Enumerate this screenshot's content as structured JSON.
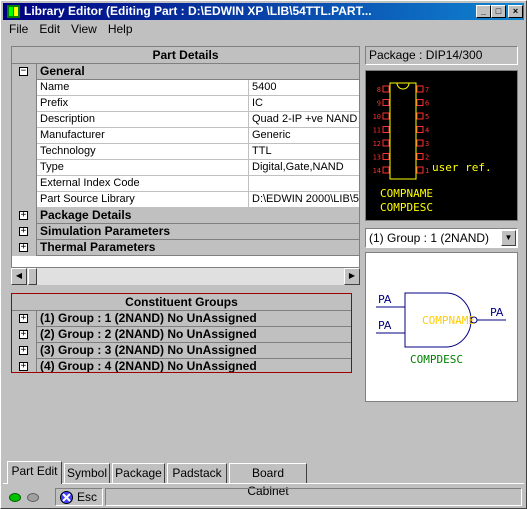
{
  "window": {
    "title": "Library Editor (Editing Part : D:\\EDWIN XP   \\LIB\\54TTL.PART...",
    "minimize": "_",
    "maximize": "□",
    "close": "×"
  },
  "menu": [
    "File",
    "Edit",
    "View",
    "Help"
  ],
  "part_details": {
    "header": "Part Details",
    "general_label": "General",
    "properties": [
      {
        "name": "Name",
        "value": "5400"
      },
      {
        "name": "Prefix",
        "value": "IC"
      },
      {
        "name": "Description",
        "value": "Quad 2-IP +ve NAND"
      },
      {
        "name": "Manufacturer",
        "value": "Generic"
      },
      {
        "name": "Technology",
        "value": "TTL"
      },
      {
        "name": "Type",
        "value": "Digital,Gate,NAND"
      },
      {
        "name": "External Index Code",
        "value": ""
      },
      {
        "name": "Part Source Library",
        "value": "D:\\EDWIN 2000\\LIB\\5"
      }
    ],
    "collapsed_sections": [
      "Package Details",
      "Simulation Parameters",
      "Thermal Parameters"
    ],
    "collapsed_symbol": "⊟",
    "expand_symbol": "+"
  },
  "constituent_groups": {
    "header": "Constituent Groups",
    "items": [
      "(1) Group : 1 (2NAND) No UnAssigned",
      "(2) Group : 2 (2NAND) No UnAssigned",
      "(3) Group : 3 (2NAND) No UnAssigned",
      "(4) Group : 4 (2NAND) No UnAssigned"
    ]
  },
  "package": {
    "label": "Package : DIP14/300",
    "left_pins": [
      "8",
      "9",
      "10",
      "11",
      "12",
      "13",
      "14"
    ],
    "right_pins": [
      "7",
      "6",
      "5",
      "4",
      "3",
      "2",
      "1"
    ],
    "user_ref": "user ref.",
    "compname": "COMPNAME",
    "compdesc": "COMPDESC"
  },
  "group_select": {
    "value": "(1) Group : 1 (2NAND)"
  },
  "symbol": {
    "pin_a": "PA",
    "pin_b": "PA",
    "pin_out": "PA",
    "compname": "COMPNAME",
    "compdesc": "COMPDESC"
  },
  "tabs": [
    "Part Edit",
    "Symbol",
    "Package",
    "Padstack",
    "Board Cabinet"
  ],
  "status": {
    "esc_label": "Esc"
  },
  "colors": {
    "title_start": "#000080",
    "title_end": "#1084d0",
    "pkg_background": "#000000",
    "pkg_pin": "#ff3030",
    "pkg_text": "#ffff00",
    "symbol_body": "#000080",
    "symbol_compname": "#ffcc00",
    "symbol_compdesc": "#008000"
  }
}
